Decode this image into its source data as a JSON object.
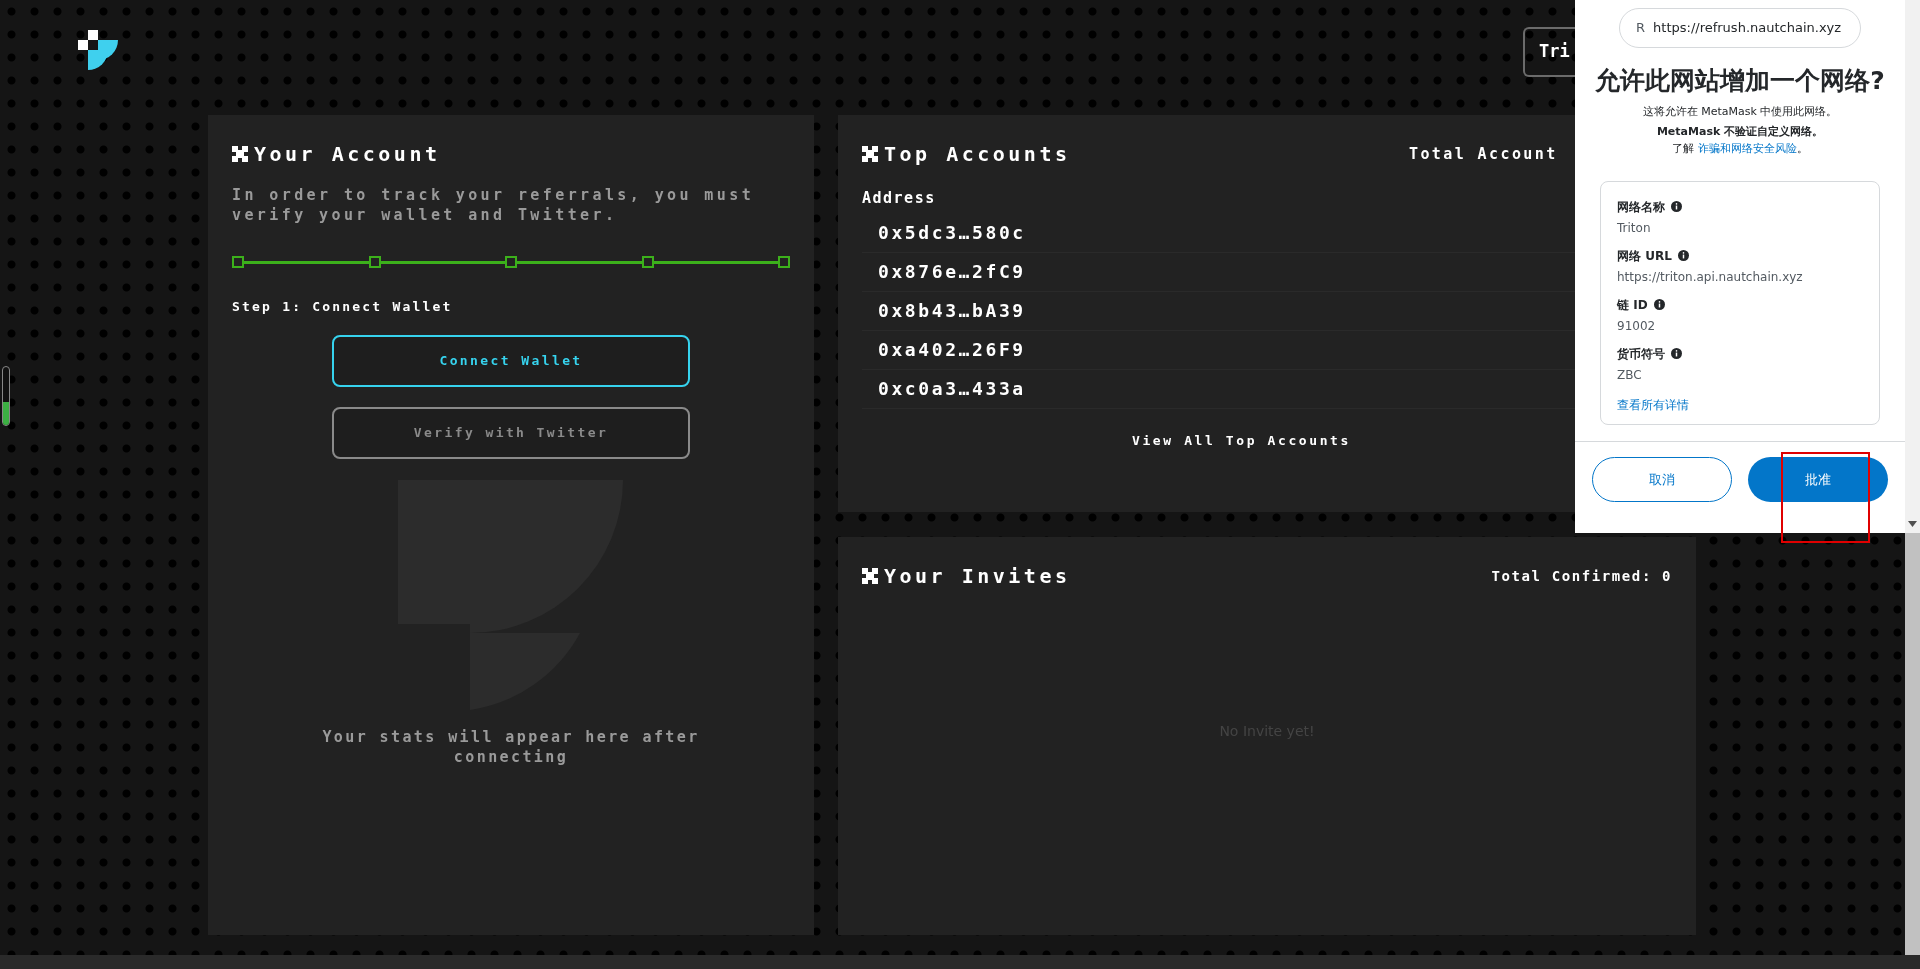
{
  "header_button": {
    "label": "Tri"
  },
  "side_meter": {
    "level": 0.4
  },
  "account_panel": {
    "title": "Your Account",
    "description": "In order to track your referrals, you must verify your wallet and Twitter.",
    "step_label": "Step 1: Connect Wallet",
    "buttons": [
      {
        "label": "Connect Wallet",
        "disabled": false
      },
      {
        "label": "Verify with Twitter",
        "disabled": true
      }
    ],
    "steps": [
      {
        "completed": true
      },
      {
        "completed": true
      },
      {
        "completed": true
      },
      {
        "completed": true
      },
      {
        "completed": true
      }
    ],
    "stats_message": "Your stats will appear here after connecting"
  },
  "top_accounts": {
    "title": "Top Accounts",
    "total_label": "Total Account",
    "column": "Address",
    "rows": [
      "0x5dc3…580c",
      "0x876e…2fC9",
      "0x8b43…bA39",
      "0xa402…26F9",
      "0xc0a3…433a"
    ],
    "view_all": "View All Top Accounts"
  },
  "invites": {
    "title": "Your Invites",
    "total_label": "Total Confirmed: 0",
    "empty_message": "No Invite yet!"
  },
  "dialog": {
    "site_initial": "R",
    "site_url": "https://refrush.nautchain.xyz",
    "title": "允许此网站增加一个网络?",
    "subtitle": "这将允许在 MetaMask 中使用此网络。",
    "warning": "MetaMask 不验证自定义网络。",
    "learn_prefix": "了解 ",
    "learn_link": "诈骗和网络安全风险",
    "learn_suffix": "。",
    "fields": [
      {
        "label": "网络名称",
        "value": "Triton"
      },
      {
        "label": "网络 URL",
        "value": "https://triton.api.nautchain.xyz"
      },
      {
        "label": "链 ID",
        "value": "91002"
      },
      {
        "label": "货币符号",
        "value": "ZBC"
      }
    ],
    "details_link": "查看所有详情",
    "cancel": "取消",
    "approve": "批准",
    "approve_highlighted": true
  }
}
